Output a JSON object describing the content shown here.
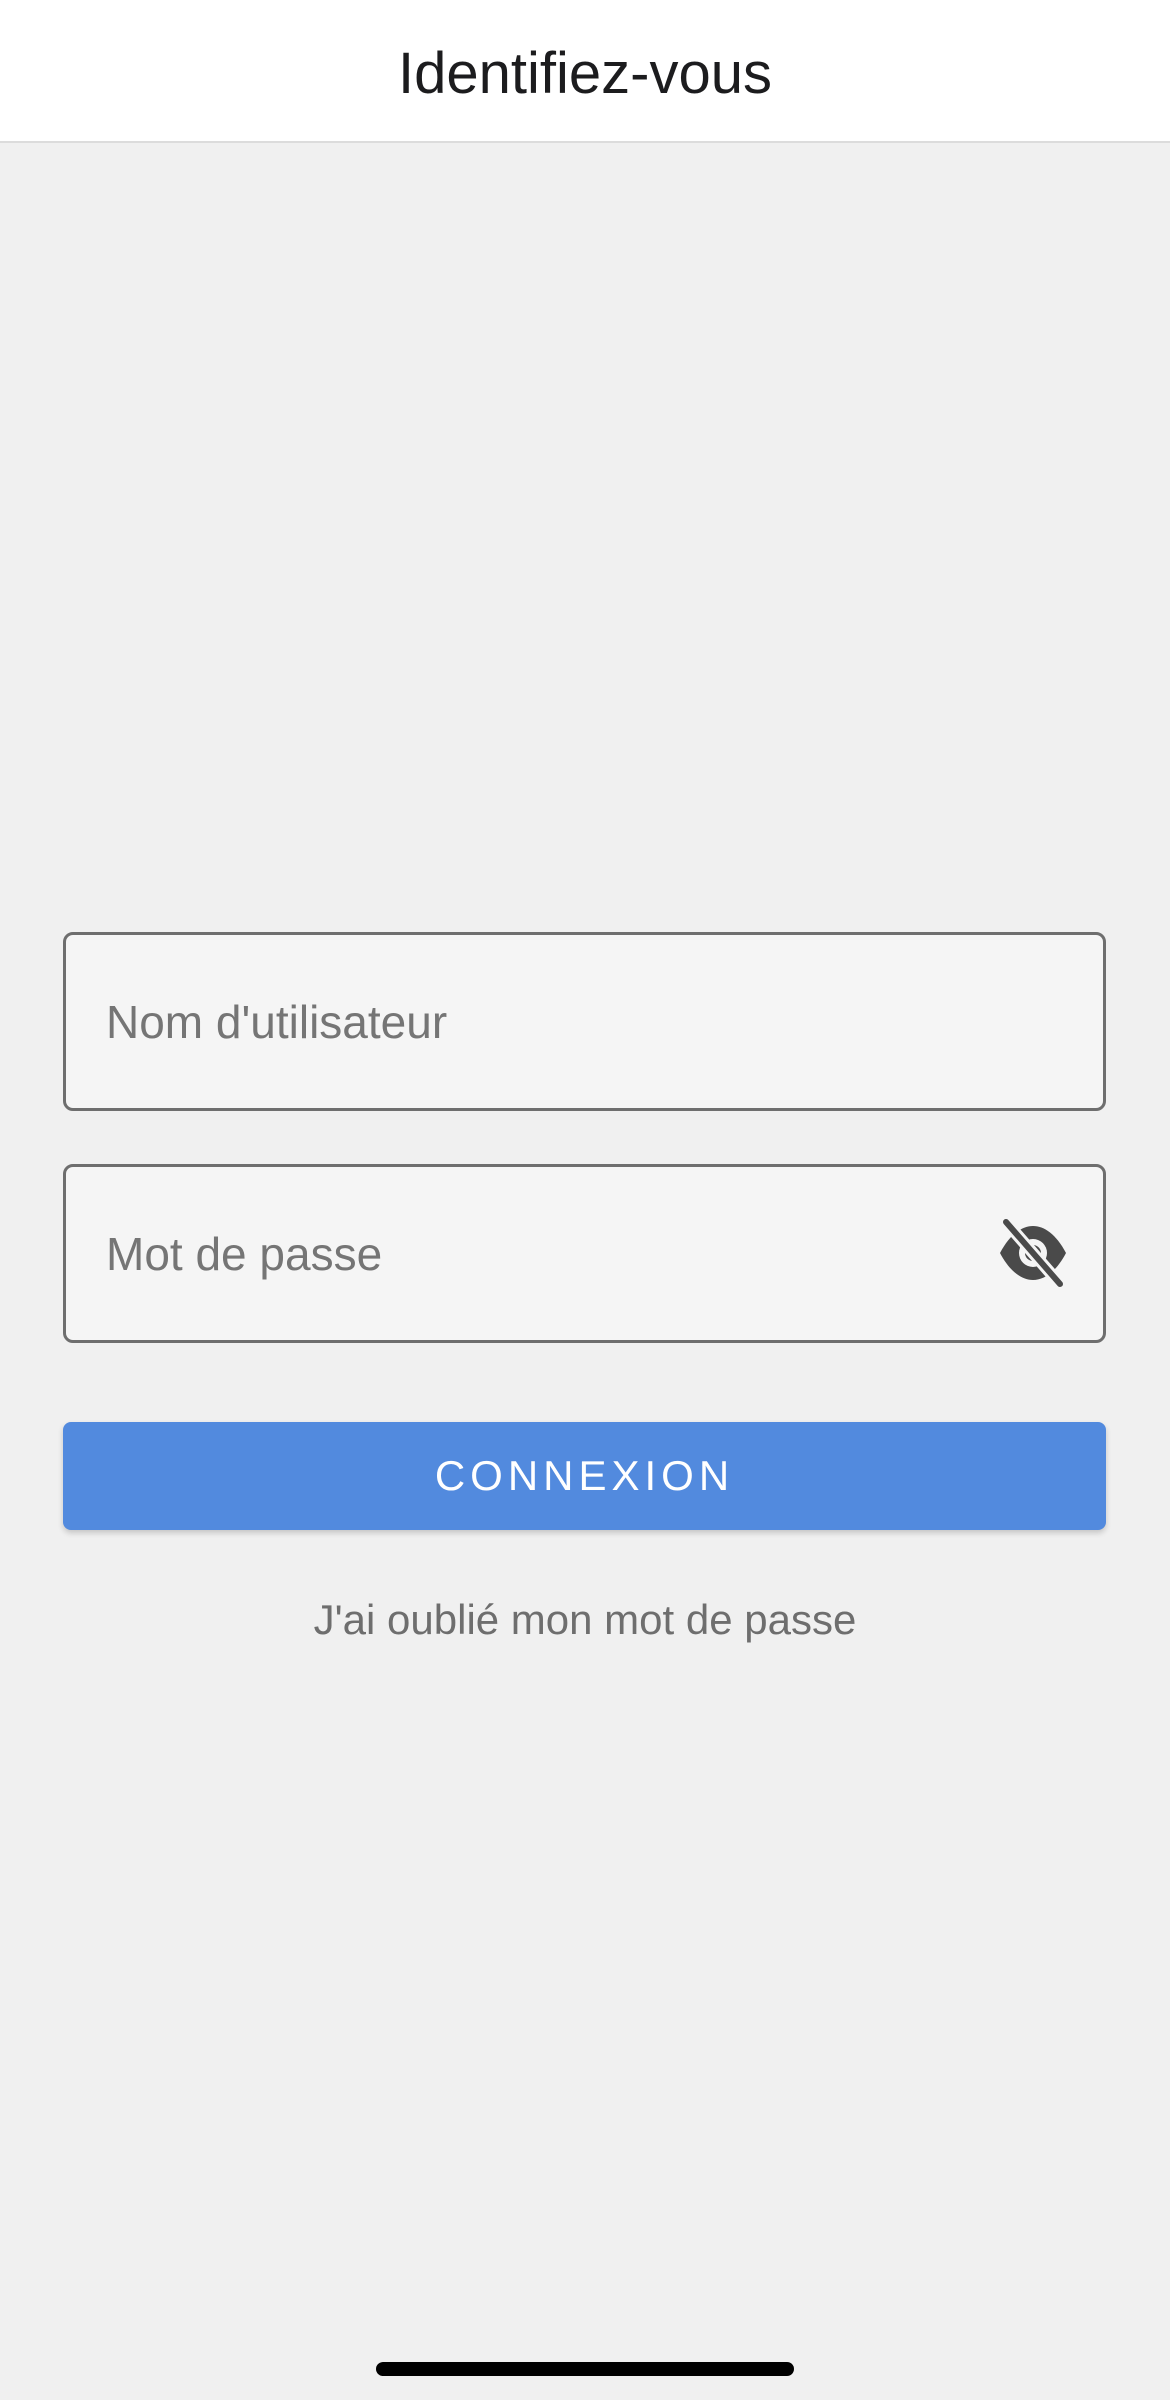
{
  "header": {
    "title": "Identifiez-vous"
  },
  "form": {
    "username": {
      "placeholder": "Nom d'utilisateur",
      "value": ""
    },
    "password": {
      "placeholder": "Mot de passe",
      "value": "",
      "toggle_icon": "eye-off-icon"
    },
    "login_label": "CONNEXION",
    "forgot_label": "J'ai oublié mon mot de passe"
  },
  "colors": {
    "accent": "#528ade",
    "background": "#f0f0f0",
    "header_background": "#ffffff"
  }
}
